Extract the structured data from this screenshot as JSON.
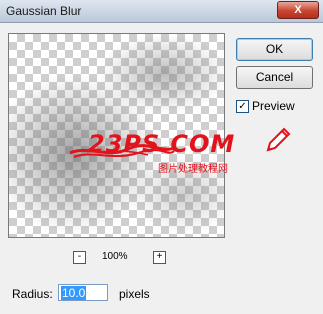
{
  "window": {
    "title": "Gaussian Blur",
    "close_label": "X"
  },
  "buttons": {
    "ok": "OK",
    "cancel": "Cancel"
  },
  "preview": {
    "label": "Preview",
    "checked": true,
    "check_mark": "✓"
  },
  "zoom": {
    "minus": "-",
    "level": "100%",
    "plus": "+"
  },
  "radius": {
    "label": "Radius:",
    "value": "10.0",
    "unit": "pixels"
  },
  "watermark": {
    "text": "23PS.COM",
    "subtext": "图片处理教程网"
  }
}
